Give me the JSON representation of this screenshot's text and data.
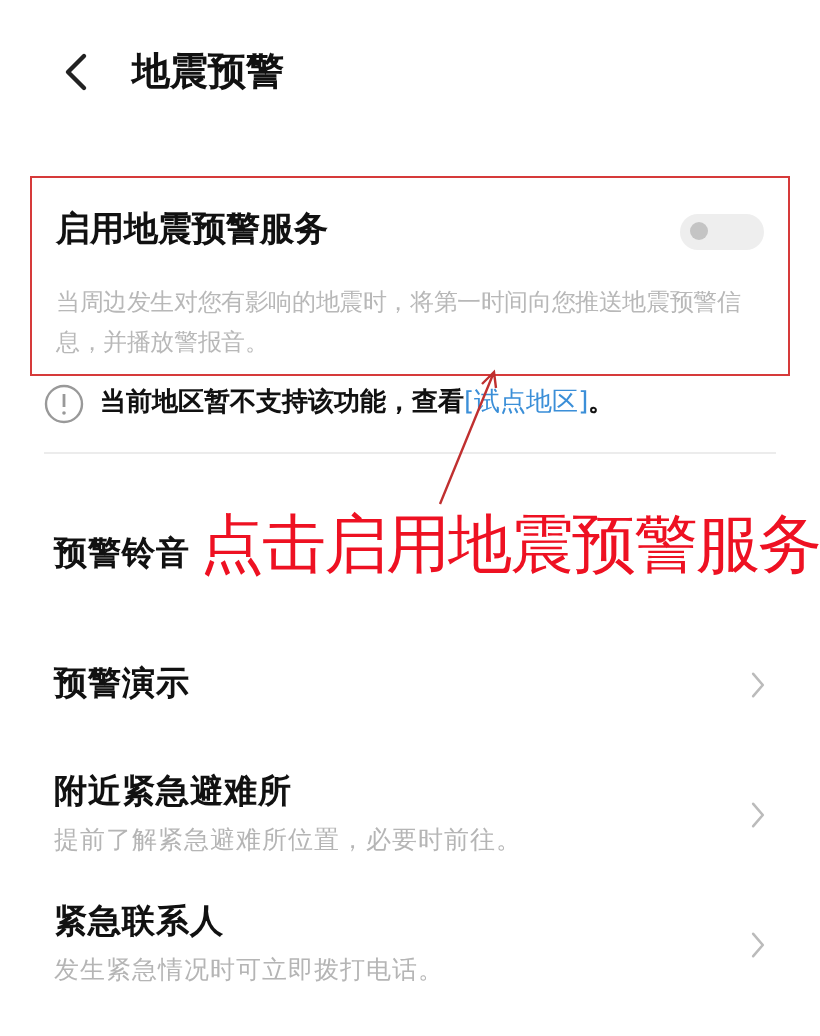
{
  "header": {
    "title": "地震预警"
  },
  "service": {
    "title": "启用地震预警服务",
    "on": false,
    "description": "当周边发生对您有影响的地震时，将第一时间向您推送地震预警信息，并播放警报音。",
    "highlighted": true
  },
  "notice": {
    "text": "当前地区暂不支持该功能，查看",
    "link": "[试点地区]",
    "tail": "。"
  },
  "items": [
    {
      "title": "预警铃音",
      "chevron": false
    },
    {
      "title": "预警演示",
      "chevron": true
    },
    {
      "title": "附近紧急避难所",
      "subtitle": "提前了解紧急避难所位置，必要时前往。",
      "chevron": true
    },
    {
      "title": "紧急联系人",
      "subtitle": "发生紧急情况时可立即拨打电话。",
      "chevron": true
    }
  ],
  "annotation": {
    "text": "点击启用地震预警服务"
  }
}
